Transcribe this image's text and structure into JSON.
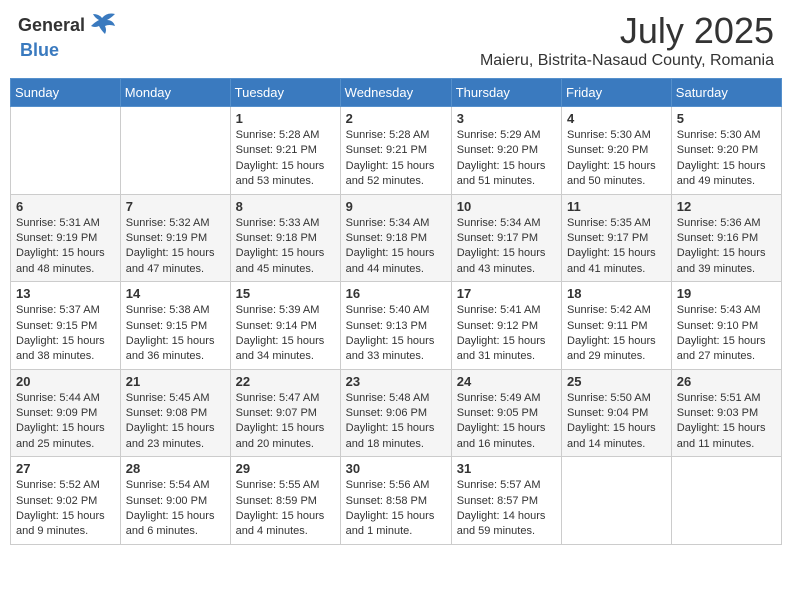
{
  "header": {
    "logo_general": "General",
    "logo_blue": "Blue",
    "month": "July 2025",
    "location": "Maieru, Bistrita-Nasaud County, Romania"
  },
  "weekdays": [
    "Sunday",
    "Monday",
    "Tuesday",
    "Wednesday",
    "Thursday",
    "Friday",
    "Saturday"
  ],
  "weeks": [
    [
      {
        "day": "",
        "sunrise": "",
        "sunset": "",
        "daylight": ""
      },
      {
        "day": "",
        "sunrise": "",
        "sunset": "",
        "daylight": ""
      },
      {
        "day": "1",
        "sunrise": "Sunrise: 5:28 AM",
        "sunset": "Sunset: 9:21 PM",
        "daylight": "Daylight: 15 hours and 53 minutes."
      },
      {
        "day": "2",
        "sunrise": "Sunrise: 5:28 AM",
        "sunset": "Sunset: 9:21 PM",
        "daylight": "Daylight: 15 hours and 52 minutes."
      },
      {
        "day": "3",
        "sunrise": "Sunrise: 5:29 AM",
        "sunset": "Sunset: 9:20 PM",
        "daylight": "Daylight: 15 hours and 51 minutes."
      },
      {
        "day": "4",
        "sunrise": "Sunrise: 5:30 AM",
        "sunset": "Sunset: 9:20 PM",
        "daylight": "Daylight: 15 hours and 50 minutes."
      },
      {
        "day": "5",
        "sunrise": "Sunrise: 5:30 AM",
        "sunset": "Sunset: 9:20 PM",
        "daylight": "Daylight: 15 hours and 49 minutes."
      }
    ],
    [
      {
        "day": "6",
        "sunrise": "Sunrise: 5:31 AM",
        "sunset": "Sunset: 9:19 PM",
        "daylight": "Daylight: 15 hours and 48 minutes."
      },
      {
        "day": "7",
        "sunrise": "Sunrise: 5:32 AM",
        "sunset": "Sunset: 9:19 PM",
        "daylight": "Daylight: 15 hours and 47 minutes."
      },
      {
        "day": "8",
        "sunrise": "Sunrise: 5:33 AM",
        "sunset": "Sunset: 9:18 PM",
        "daylight": "Daylight: 15 hours and 45 minutes."
      },
      {
        "day": "9",
        "sunrise": "Sunrise: 5:34 AM",
        "sunset": "Sunset: 9:18 PM",
        "daylight": "Daylight: 15 hours and 44 minutes."
      },
      {
        "day": "10",
        "sunrise": "Sunrise: 5:34 AM",
        "sunset": "Sunset: 9:17 PM",
        "daylight": "Daylight: 15 hours and 43 minutes."
      },
      {
        "day": "11",
        "sunrise": "Sunrise: 5:35 AM",
        "sunset": "Sunset: 9:17 PM",
        "daylight": "Daylight: 15 hours and 41 minutes."
      },
      {
        "day": "12",
        "sunrise": "Sunrise: 5:36 AM",
        "sunset": "Sunset: 9:16 PM",
        "daylight": "Daylight: 15 hours and 39 minutes."
      }
    ],
    [
      {
        "day": "13",
        "sunrise": "Sunrise: 5:37 AM",
        "sunset": "Sunset: 9:15 PM",
        "daylight": "Daylight: 15 hours and 38 minutes."
      },
      {
        "day": "14",
        "sunrise": "Sunrise: 5:38 AM",
        "sunset": "Sunset: 9:15 PM",
        "daylight": "Daylight: 15 hours and 36 minutes."
      },
      {
        "day": "15",
        "sunrise": "Sunrise: 5:39 AM",
        "sunset": "Sunset: 9:14 PM",
        "daylight": "Daylight: 15 hours and 34 minutes."
      },
      {
        "day": "16",
        "sunrise": "Sunrise: 5:40 AM",
        "sunset": "Sunset: 9:13 PM",
        "daylight": "Daylight: 15 hours and 33 minutes."
      },
      {
        "day": "17",
        "sunrise": "Sunrise: 5:41 AM",
        "sunset": "Sunset: 9:12 PM",
        "daylight": "Daylight: 15 hours and 31 minutes."
      },
      {
        "day": "18",
        "sunrise": "Sunrise: 5:42 AM",
        "sunset": "Sunset: 9:11 PM",
        "daylight": "Daylight: 15 hours and 29 minutes."
      },
      {
        "day": "19",
        "sunrise": "Sunrise: 5:43 AM",
        "sunset": "Sunset: 9:10 PM",
        "daylight": "Daylight: 15 hours and 27 minutes."
      }
    ],
    [
      {
        "day": "20",
        "sunrise": "Sunrise: 5:44 AM",
        "sunset": "Sunset: 9:09 PM",
        "daylight": "Daylight: 15 hours and 25 minutes."
      },
      {
        "day": "21",
        "sunrise": "Sunrise: 5:45 AM",
        "sunset": "Sunset: 9:08 PM",
        "daylight": "Daylight: 15 hours and 23 minutes."
      },
      {
        "day": "22",
        "sunrise": "Sunrise: 5:47 AM",
        "sunset": "Sunset: 9:07 PM",
        "daylight": "Daylight: 15 hours and 20 minutes."
      },
      {
        "day": "23",
        "sunrise": "Sunrise: 5:48 AM",
        "sunset": "Sunset: 9:06 PM",
        "daylight": "Daylight: 15 hours and 18 minutes."
      },
      {
        "day": "24",
        "sunrise": "Sunrise: 5:49 AM",
        "sunset": "Sunset: 9:05 PM",
        "daylight": "Daylight: 15 hours and 16 minutes."
      },
      {
        "day": "25",
        "sunrise": "Sunrise: 5:50 AM",
        "sunset": "Sunset: 9:04 PM",
        "daylight": "Daylight: 15 hours and 14 minutes."
      },
      {
        "day": "26",
        "sunrise": "Sunrise: 5:51 AM",
        "sunset": "Sunset: 9:03 PM",
        "daylight": "Daylight: 15 hours and 11 minutes."
      }
    ],
    [
      {
        "day": "27",
        "sunrise": "Sunrise: 5:52 AM",
        "sunset": "Sunset: 9:02 PM",
        "daylight": "Daylight: 15 hours and 9 minutes."
      },
      {
        "day": "28",
        "sunrise": "Sunrise: 5:54 AM",
        "sunset": "Sunset: 9:00 PM",
        "daylight": "Daylight: 15 hours and 6 minutes."
      },
      {
        "day": "29",
        "sunrise": "Sunrise: 5:55 AM",
        "sunset": "Sunset: 8:59 PM",
        "daylight": "Daylight: 15 hours and 4 minutes."
      },
      {
        "day": "30",
        "sunrise": "Sunrise: 5:56 AM",
        "sunset": "Sunset: 8:58 PM",
        "daylight": "Daylight: 15 hours and 1 minute."
      },
      {
        "day": "31",
        "sunrise": "Sunrise: 5:57 AM",
        "sunset": "Sunset: 8:57 PM",
        "daylight": "Daylight: 14 hours and 59 minutes."
      },
      {
        "day": "",
        "sunrise": "",
        "sunset": "",
        "daylight": ""
      },
      {
        "day": "",
        "sunrise": "",
        "sunset": "",
        "daylight": ""
      }
    ]
  ]
}
